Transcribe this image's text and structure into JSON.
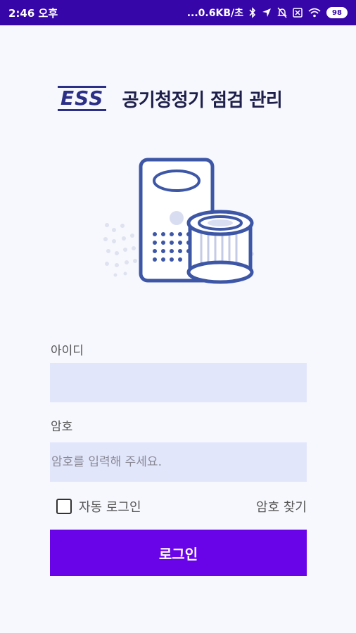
{
  "status_bar": {
    "time": "2:46 오후",
    "network_speed": "...0.6KB/초",
    "battery": "98",
    "icons": [
      "bluetooth-icon",
      "location-icon",
      "silent-icon",
      "sim-icon",
      "wifi-icon",
      "battery-icon"
    ]
  },
  "header": {
    "logo": "ESS",
    "title": "공기청정기 점검 관리"
  },
  "illustration": {
    "icon": "air-purifier-filter-icon",
    "accent": "#3d57a6"
  },
  "form": {
    "id_label": "아이디",
    "id_value": "",
    "password_label": "암호",
    "password_placeholder": "암호를 입력해 주세요.",
    "auto_login_label": "자동 로그인",
    "auto_login_checked": false,
    "find_password": "암호 찾기",
    "login_button": "로그인"
  },
  "colors": {
    "status_bar": "#3606a8",
    "primary_button": "#6a04e8",
    "input_bg": "#e2e6fb",
    "page_bg": "#f7f8fd"
  }
}
